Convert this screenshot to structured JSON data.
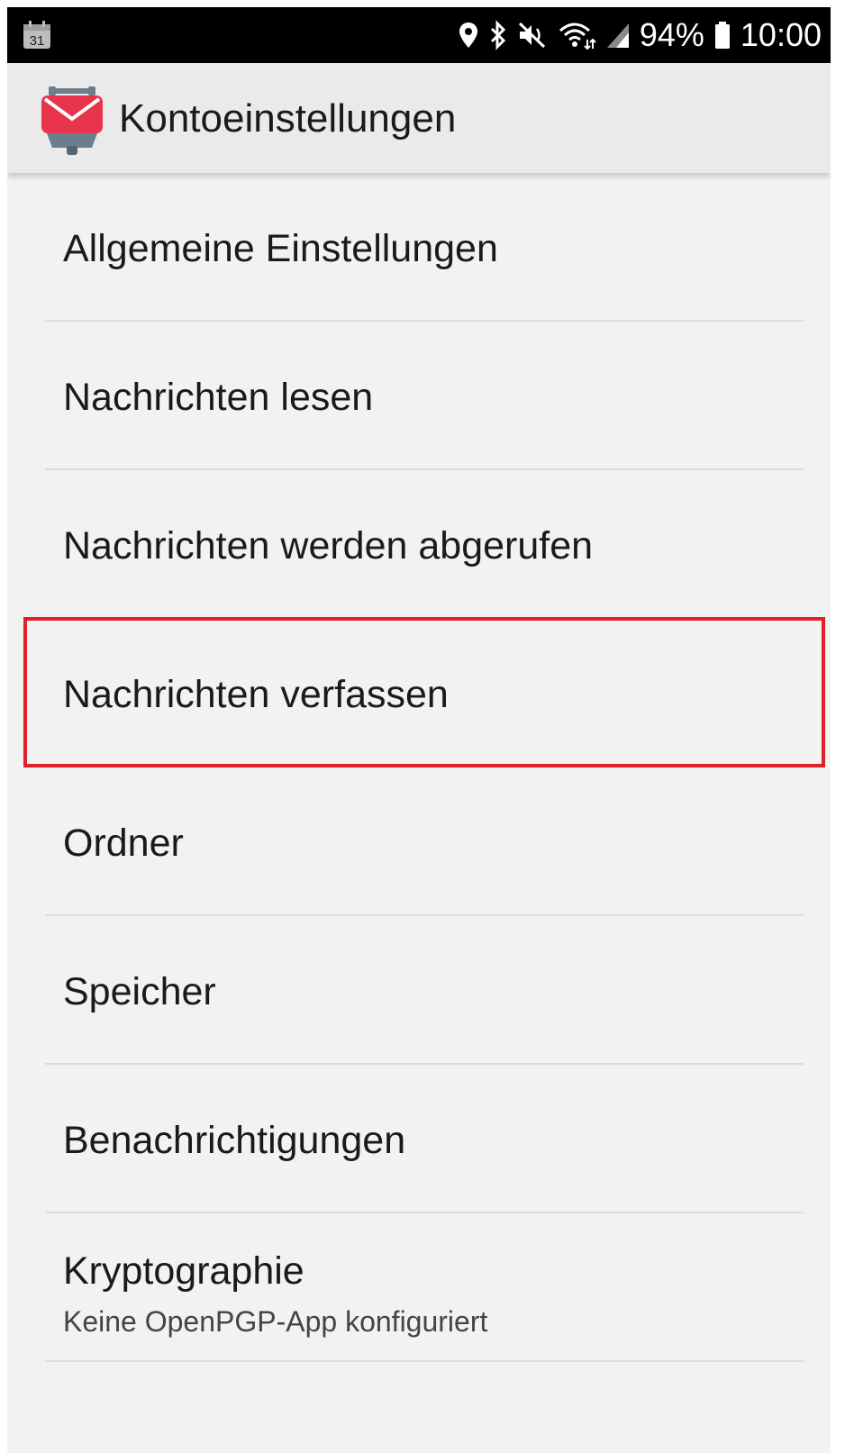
{
  "status_bar": {
    "calendar_day": "31",
    "icons": [
      "location-icon",
      "bluetooth-icon",
      "mute-icon",
      "wifi-icon",
      "signal-icon",
      "battery-icon"
    ],
    "battery_percent": "94%",
    "time": "10:00"
  },
  "app_bar": {
    "app_icon": "k9-mail-icon",
    "title": "Kontoeinstellungen"
  },
  "settings": [
    {
      "label": "Allgemeine Einstellungen"
    },
    {
      "label": "Nachrichten lesen"
    },
    {
      "label": "Nachrichten werden abgerufen"
    },
    {
      "label": "Nachrichten verfassen",
      "highlighted": true
    },
    {
      "label": "Ordner"
    },
    {
      "label": "Speicher"
    },
    {
      "label": "Benachrichtigungen"
    },
    {
      "label": "Kryptographie",
      "summary": "Keine OpenPGP-App konfiguriert"
    }
  ],
  "colors": {
    "highlight": "#e0202a",
    "app_icon_red": "#e8344a",
    "background": "#f2f2f2"
  }
}
